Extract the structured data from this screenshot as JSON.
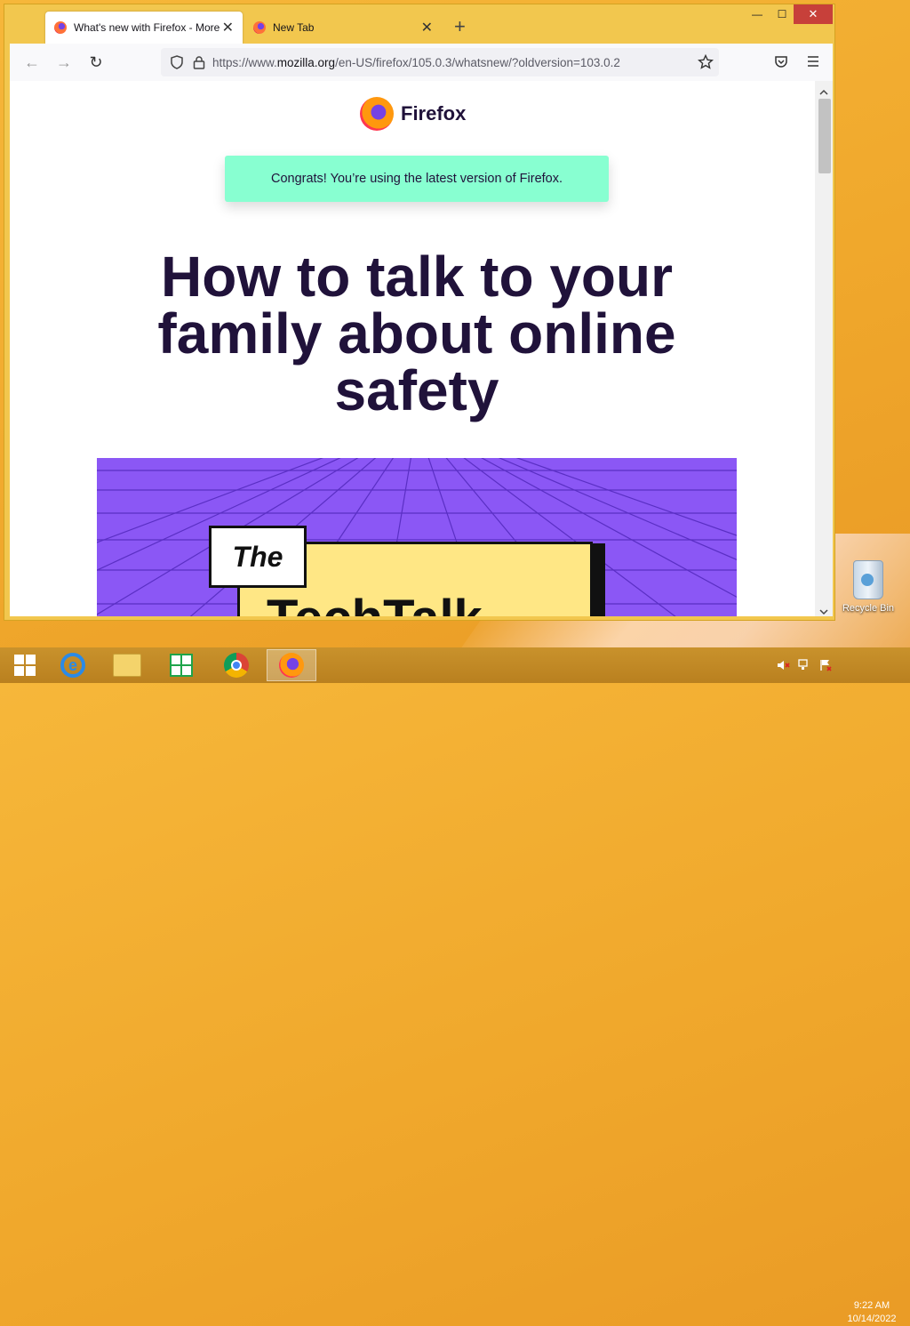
{
  "browser": {
    "tabs": [
      {
        "title": "What's new with Firefox - More",
        "close": "✕",
        "active": true
      },
      {
        "title": "New Tab",
        "close": "✕",
        "active": false
      }
    ],
    "new_tab": "+",
    "window_controls": {
      "minimize": "—",
      "maximize": "☐",
      "close": "✕"
    },
    "nav": {
      "back": "←",
      "forward": "→",
      "reload": "↻"
    },
    "url": {
      "prefix": "https://www.",
      "domain": "mozilla.org",
      "path": "/en-US/firefox/105.0.3/whatsnew/?oldversion=103.0.2"
    },
    "toolbar_icons": [
      "shield-icon",
      "lock-icon",
      "bookmark-star-icon",
      "pocket-icon",
      "menu-icon"
    ]
  },
  "page": {
    "logo_text": "Firefox",
    "banner": "Congrats! You’re using the latest version of Firefox.",
    "headline": "How to talk to your family about online safety",
    "hero": {
      "small_box": "The",
      "big_text": "TechTalk"
    }
  },
  "desktop": {
    "recycle_bin_label": "Recycle Bin",
    "clock": {
      "time": "9:22 AM",
      "date": "10/14/2022"
    }
  },
  "colors": {
    "desktop": "#f0a82c",
    "window_frame": "#f2c74e",
    "banner": "#88ffd1",
    "headline": "#20123a",
    "hero_bg": "#8b57f5",
    "close_button": "#c7403a"
  }
}
